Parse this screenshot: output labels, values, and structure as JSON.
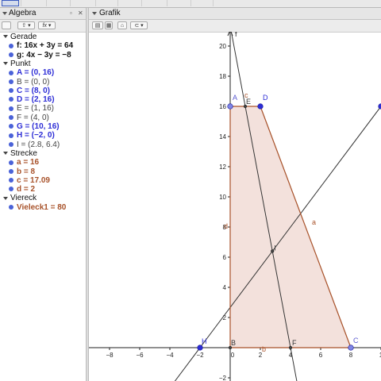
{
  "colors": {
    "point_blue": "#2d2dd6",
    "point_gray": "#444444",
    "segment_brown": "#a8522a",
    "polygon_fill": "#f1dcd6",
    "object_dot": "#4a62d8"
  },
  "algebra": {
    "title": "Algebra",
    "buttons": {
      "sort": "⇧",
      "input": "fx"
    },
    "categories": [
      {
        "label": "Gerade",
        "items": [
          {
            "text": "f: 16x + 3y = 64",
            "color": "#111111",
            "bold": true
          },
          {
            "text": "g: 4x − 3y = −8",
            "color": "#111111",
            "bold": true
          }
        ]
      },
      {
        "label": "Punkt",
        "items": [
          {
            "text": "A = (0, 16)",
            "color": "#2d2dd6",
            "bold": true
          },
          {
            "text": "B = (0, 0)",
            "color": "#444444",
            "bold": false
          },
          {
            "text": "C = (8, 0)",
            "color": "#2d2dd6",
            "bold": true
          },
          {
            "text": "D = (2, 16)",
            "color": "#2d2dd6",
            "bold": true
          },
          {
            "text": "E = (1, 16)",
            "color": "#444444",
            "bold": false
          },
          {
            "text": "F = (4, 0)",
            "color": "#444444",
            "bold": false
          },
          {
            "text": "G = (10, 16)",
            "color": "#2d2dd6",
            "bold": true
          },
          {
            "text": "H = (−2, 0)",
            "color": "#2d2dd6",
            "bold": true
          },
          {
            "text": "I = (2.8, 6.4)",
            "color": "#444444",
            "bold": false
          }
        ]
      },
      {
        "label": "Strecke",
        "items": [
          {
            "text": "a = 16",
            "color": "#a8522a",
            "bold": true
          },
          {
            "text": "b = 8",
            "color": "#a8522a",
            "bold": true
          },
          {
            "text": "c = 17.09",
            "color": "#a8522a",
            "bold": true
          },
          {
            "text": "d = 2",
            "color": "#a8522a",
            "bold": true
          }
        ]
      },
      {
        "label": "Viereck",
        "items": [
          {
            "text": "Vieleck1 = 80",
            "color": "#a8522a",
            "bold": true
          }
        ]
      }
    ]
  },
  "grafik": {
    "title": "Grafik",
    "x_ticks": [
      "−8",
      "−6",
      "−4",
      "−2",
      "0",
      "2",
      "4",
      "6",
      "8",
      "1"
    ],
    "y_ticks": [
      "−2",
      "2",
      "4",
      "6",
      "8",
      "10",
      "12",
      "14",
      "16",
      "18",
      "20"
    ],
    "point_labels": [
      "A",
      "B",
      "C",
      "D",
      "E",
      "F",
      "H",
      "I"
    ],
    "line_labels": [
      "f"
    ],
    "segment_labels": [
      "a",
      "c",
      "d",
      "b"
    ]
  },
  "chart_data": {
    "type": "scatter",
    "xlim": [
      -9.5,
      10
    ],
    "ylim": [
      -2.3,
      21.3
    ],
    "grid": false,
    "points": [
      {
        "name": "A",
        "x": 0,
        "y": 16
      },
      {
        "name": "B",
        "x": 0,
        "y": 0
      },
      {
        "name": "C",
        "x": 8,
        "y": 0
      },
      {
        "name": "D",
        "x": 2,
        "y": 16
      },
      {
        "name": "E",
        "x": 1,
        "y": 16
      },
      {
        "name": "F",
        "x": 4,
        "y": 0
      },
      {
        "name": "G",
        "x": 10,
        "y": 16
      },
      {
        "name": "H",
        "x": -2,
        "y": 0
      },
      {
        "name": "I",
        "x": 2.8,
        "y": 6.4
      }
    ],
    "lines": [
      {
        "name": "f",
        "equation": "16x + 3y = 64"
      },
      {
        "name": "g",
        "equation": "4x − 3y = −8"
      }
    ],
    "segments": [
      {
        "name": "a",
        "from": "B",
        "to": "A",
        "length": 16
      },
      {
        "name": "b",
        "from": "C",
        "to": "B",
        "length": 8
      },
      {
        "name": "c",
        "from": "D",
        "to": "C",
        "length": 17.09
      },
      {
        "name": "d",
        "from": "A",
        "to": "D",
        "length": 2
      }
    ],
    "polygon": {
      "name": "Vieleck1",
      "vertices": [
        "A",
        "B",
        "C",
        "D"
      ],
      "area": 80
    }
  }
}
